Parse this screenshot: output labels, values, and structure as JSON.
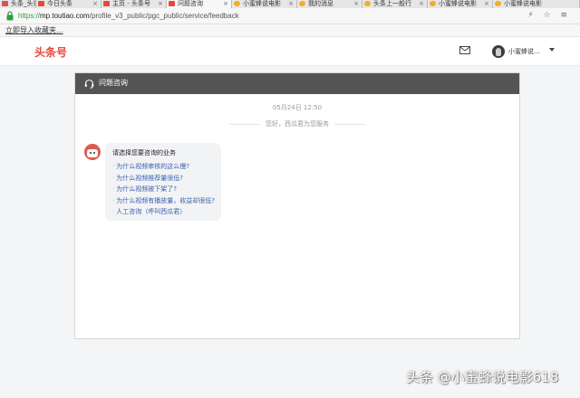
{
  "browser": {
    "tabs": [
      {
        "label": "头条_头条",
        "active": false,
        "color": "#d9534f"
      },
      {
        "label": "今日头条",
        "active": false,
        "color": "#e8483c"
      },
      {
        "label": "主页 - 头条号",
        "active": false,
        "color": "#e8483c"
      },
      {
        "label": "问题咨询",
        "active": true,
        "color": "#e8483c"
      },
      {
        "label": "小蜜蜂说电影",
        "active": false,
        "color": "#f0ad2b"
      },
      {
        "label": "我的消息",
        "active": false,
        "color": "#f0ad2b"
      },
      {
        "label": "头条上一般行",
        "active": false,
        "color": "#f0ad2b"
      },
      {
        "label": "小蜜蜂说电影",
        "active": false,
        "color": "#f0ad2b"
      },
      {
        "label": "小蜜蜂说电影",
        "active": false,
        "color": "#f0ad2b"
      }
    ],
    "url_scheme": "https://",
    "url_domain": "mp.toutiao.com",
    "url_path": "/profile_v3_public/pgc_public/service/feedback",
    "address_icons": "⚡ ☆ ≡",
    "bookmark": "立即导入收藏夹..."
  },
  "header": {
    "logo": "头条号",
    "username": "小蜜蜂说...",
    "logo_color": "#e8483c"
  },
  "chat": {
    "title": "问题咨询",
    "timestamp": "05月24日 12:50",
    "system_message": "您好，西瓜君为您服务",
    "bubble_title": "请选择您要咨询的业务",
    "options": [
      "为什么视频审核的这么慢?",
      "为什么视频推荐量很低?",
      "为什么视频被下架了?",
      "为什么视频有播放量，收益却很低?",
      "人工咨询（呼叫西瓜君）"
    ],
    "link_color": "#3a63b0",
    "header_bg": "#545454"
  },
  "watermark": "头条 @小蜜蜂说电影618"
}
